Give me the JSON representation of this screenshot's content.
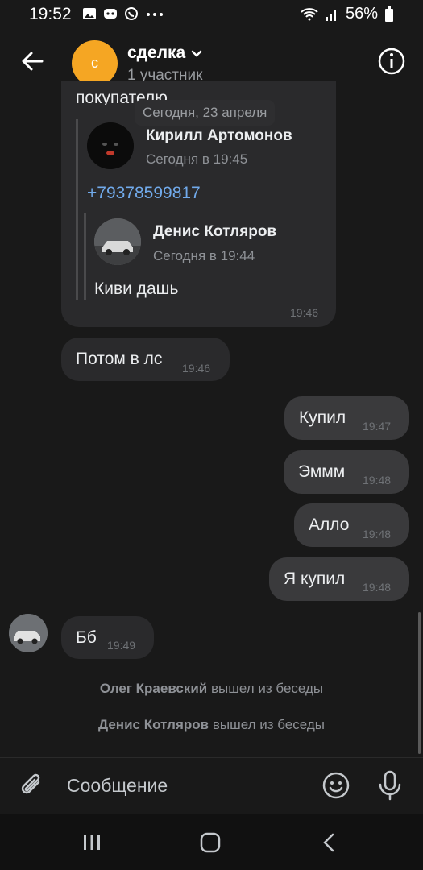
{
  "status": {
    "time": "19:52",
    "battery": "56%"
  },
  "header": {
    "avatar_letter": "с",
    "title": "сделка",
    "subtitle": "1 участник"
  },
  "chat": {
    "cut_text": "покупателю",
    "date_chip": "Сегодня, 23 апреля",
    "forward1": {
      "name": "Кирилл Артомонов",
      "time": "Сегодня в 19:45",
      "text": "+79378599817"
    },
    "forward2": {
      "name": "Денис Котляров",
      "time": "Сегодня в 19:44",
      "text": "Киви дашь"
    },
    "forward_time": "19:46",
    "messages": [
      {
        "text": "Потом в лс",
        "time": "19:46"
      },
      {
        "text": "Купил",
        "time": "19:47"
      },
      {
        "text": "Эммм",
        "time": "19:48"
      },
      {
        "text": "Алло",
        "time": "19:48"
      },
      {
        "text": "Я купил",
        "time": "19:48"
      },
      {
        "text": "Бб",
        "time": "19:49"
      }
    ],
    "system": [
      {
        "name": "Олег Краевский",
        "action": "вышел из беседы"
      },
      {
        "name": "Денис Котляров",
        "action": "вышел из беседы"
      }
    ]
  },
  "input": {
    "placeholder": "Сообщение"
  }
}
